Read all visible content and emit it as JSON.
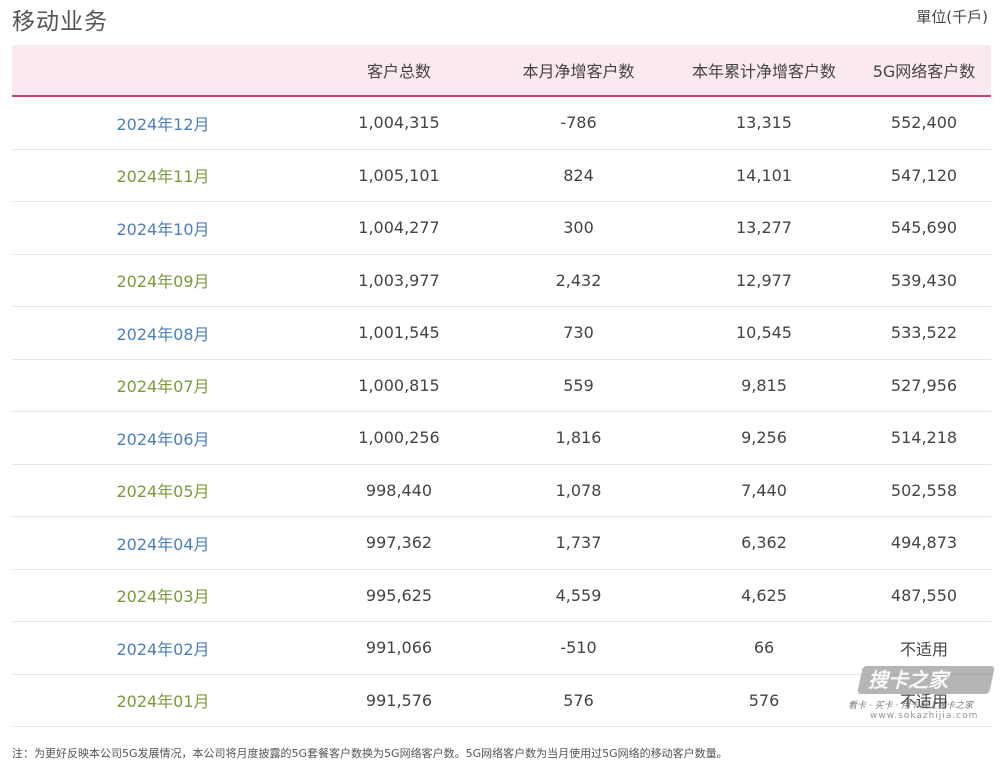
{
  "header": {
    "title": "移动业务",
    "unit": "單位(千戶)"
  },
  "table": {
    "columns": [
      "",
      "客户总数",
      "本月净增客户数",
      "本年累计净增客户数",
      "5G网络客户数"
    ],
    "rows": [
      {
        "month": "2024年12月",
        "total": "1,004,315",
        "net_new": "-786",
        "ytd_net_new": "13,315",
        "g5": "552,400",
        "month_color": "#4a7fbd"
      },
      {
        "month": "2024年11月",
        "total": "1,005,101",
        "net_new": "824",
        "ytd_net_new": "14,101",
        "g5": "547,120",
        "month_color": "#7a9a3a"
      },
      {
        "month": "2024年10月",
        "total": "1,004,277",
        "net_new": "300",
        "ytd_net_new": "13,277",
        "g5": "545,690",
        "month_color": "#4a7fbd"
      },
      {
        "month": "2024年09月",
        "total": "1,003,977",
        "net_new": "2,432",
        "ytd_net_new": "12,977",
        "g5": "539,430",
        "month_color": "#7a9a3a"
      },
      {
        "month": "2024年08月",
        "total": "1,001,545",
        "net_new": "730",
        "ytd_net_new": "10,545",
        "g5": "533,522",
        "month_color": "#4a7fbd"
      },
      {
        "month": "2024年07月",
        "total": "1,000,815",
        "net_new": "559",
        "ytd_net_new": "9,815",
        "g5": "527,956",
        "month_color": "#7a9a3a"
      },
      {
        "month": "2024年06月",
        "total": "1,000,256",
        "net_new": "1,816",
        "ytd_net_new": "9,256",
        "g5": "514,218",
        "month_color": "#4a7fbd"
      },
      {
        "month": "2024年05月",
        "total": "998,440",
        "net_new": "1,078",
        "ytd_net_new": "7,440",
        "g5": "502,558",
        "month_color": "#7a9a3a"
      },
      {
        "month": "2024年04月",
        "total": "997,362",
        "net_new": "1,737",
        "ytd_net_new": "6,362",
        "g5": "494,873",
        "month_color": "#4a7fbd"
      },
      {
        "month": "2024年03月",
        "total": "995,625",
        "net_new": "4,559",
        "ytd_net_new": "4,625",
        "g5": "487,550",
        "month_color": "#7a9a3a"
      },
      {
        "month": "2024年02月",
        "total": "991,066",
        "net_new": "-510",
        "ytd_net_new": "66",
        "g5": "不适用",
        "month_color": "#4a7fbd"
      },
      {
        "month": "2024年01月",
        "total": "991,576",
        "net_new": "576",
        "ytd_net_new": "576",
        "g5": "不适用",
        "month_color": "#7a9a3a"
      }
    ]
  },
  "footnote": "注：为更好反映本公司5G发展情况，本公司将月度披露的5G套餐客户数换为5G网络客户数。5G网络客户数为当月使用过5G网络的移动客户数量。",
  "watermark": {
    "logo_text": "搜卡之家",
    "tagline": "看卡 · 买卡 · 用卡就上搜卡之家",
    "url": "www.sokazhijia.com"
  },
  "colors": {
    "header_bg": "#fbe9f1",
    "header_border": "#c8407a",
    "month_blue": "#4a7fbd",
    "month_green": "#7a9a3a"
  }
}
